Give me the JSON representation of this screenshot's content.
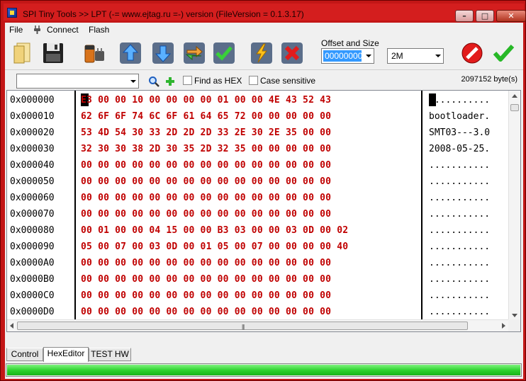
{
  "window": {
    "title": "SPI Tiny Tools >> LPT (-= www.ejtag.ru =-) version (FileVersion = 0.1.3.17)",
    "minimize_glyph": "–",
    "maximize_glyph": "□",
    "close_glyph": "✕"
  },
  "menu": {
    "items": [
      "File",
      "Connect",
      "Flash"
    ]
  },
  "toolbar": {
    "icons": [
      "open-file-icon",
      "save-icon",
      "read-chip-icon",
      "upload-icon",
      "download-icon",
      "refresh-icon",
      "verify-icon",
      "program-icon",
      "erase-icon"
    ],
    "offset_group_label": "Offset and Size",
    "offset_value": "00000000",
    "size_value": "2M",
    "stop_icon": "stop-icon",
    "ok_icon": "check-icon"
  },
  "search": {
    "query": "",
    "find_as_hex_label": "Find as HEX",
    "case_sensitive_label": "Case sensitive",
    "byte_count": "2097152 byte(s)"
  },
  "hex_editor": {
    "rows": [
      {
        "address": "0x000000",
        "hex": "E3 00 00 10 00 00 00 00 01 00 00 4E 43 52 43",
        "ascii": "..........."
      },
      {
        "address": "0x000010",
        "hex": "62 6F 6F 74 6C 6F 61 64 65 72 00 00 00 00 00",
        "ascii": "bootloader."
      },
      {
        "address": "0x000020",
        "hex": "53 4D 54 30 33 2D 2D 2D 33 2E 30 2E 35 00 00",
        "ascii": "SMT03---3.0"
      },
      {
        "address": "0x000030",
        "hex": "32 30 30 38 2D 30 35 2D 32 35 00 00 00 00 00",
        "ascii": "2008-05-25."
      },
      {
        "address": "0x000040",
        "hex": "00 00 00 00 00 00 00 00 00 00 00 00 00 00 00",
        "ascii": "..........."
      },
      {
        "address": "0x000050",
        "hex": "00 00 00 00 00 00 00 00 00 00 00 00 00 00 00",
        "ascii": "..........."
      },
      {
        "address": "0x000060",
        "hex": "00 00 00 00 00 00 00 00 00 00 00 00 00 00 00",
        "ascii": "..........."
      },
      {
        "address": "0x000070",
        "hex": "00 00 00 00 00 00 00 00 00 00 00 00 00 00 00",
        "ascii": "..........."
      },
      {
        "address": "0x000080",
        "hex": "00 01 00 00 04 15 00 00 B3 03 00 00 03 0D 00 02",
        "ascii": "..........."
      },
      {
        "address": "0x000090",
        "hex": "05 00 07 00 03 0D 00 01 05 00 07 00 00 00 00 40",
        "ascii": "..........."
      },
      {
        "address": "0x0000A0",
        "hex": "00 00 00 00 00 00 00 00 00 00 00 00 00 00 00",
        "ascii": "..........."
      },
      {
        "address": "0x0000B0",
        "hex": "00 00 00 00 00 00 00 00 00 00 00 00 00 00 00",
        "ascii": "..........."
      },
      {
        "address": "0x0000C0",
        "hex": "00 00 00 00 00 00 00 00 00 00 00 00 00 00 00",
        "ascii": "..........."
      },
      {
        "address": "0x0000D0",
        "hex": "00 00 00 00 00 00 00 00 00 00 00 00 00 00 00",
        "ascii": "..........."
      },
      {
        "address": "0x0000E0",
        "hex": "00 00 00 00 00 00 00 00 00 00 00 00 00 00 00",
        "ascii": "..........."
      }
    ],
    "hscroll_grip": "|||"
  },
  "tabs": [
    {
      "label": "Control",
      "active": false
    },
    {
      "label": "HexEditor",
      "active": true
    },
    {
      "label": "TEST HW",
      "active": false
    }
  ],
  "progress": {
    "fraction": 1.0
  },
  "colors": {
    "hex_text": "#c00000",
    "progress": "#2bd12b",
    "offset_highlight": "#3399ff"
  }
}
